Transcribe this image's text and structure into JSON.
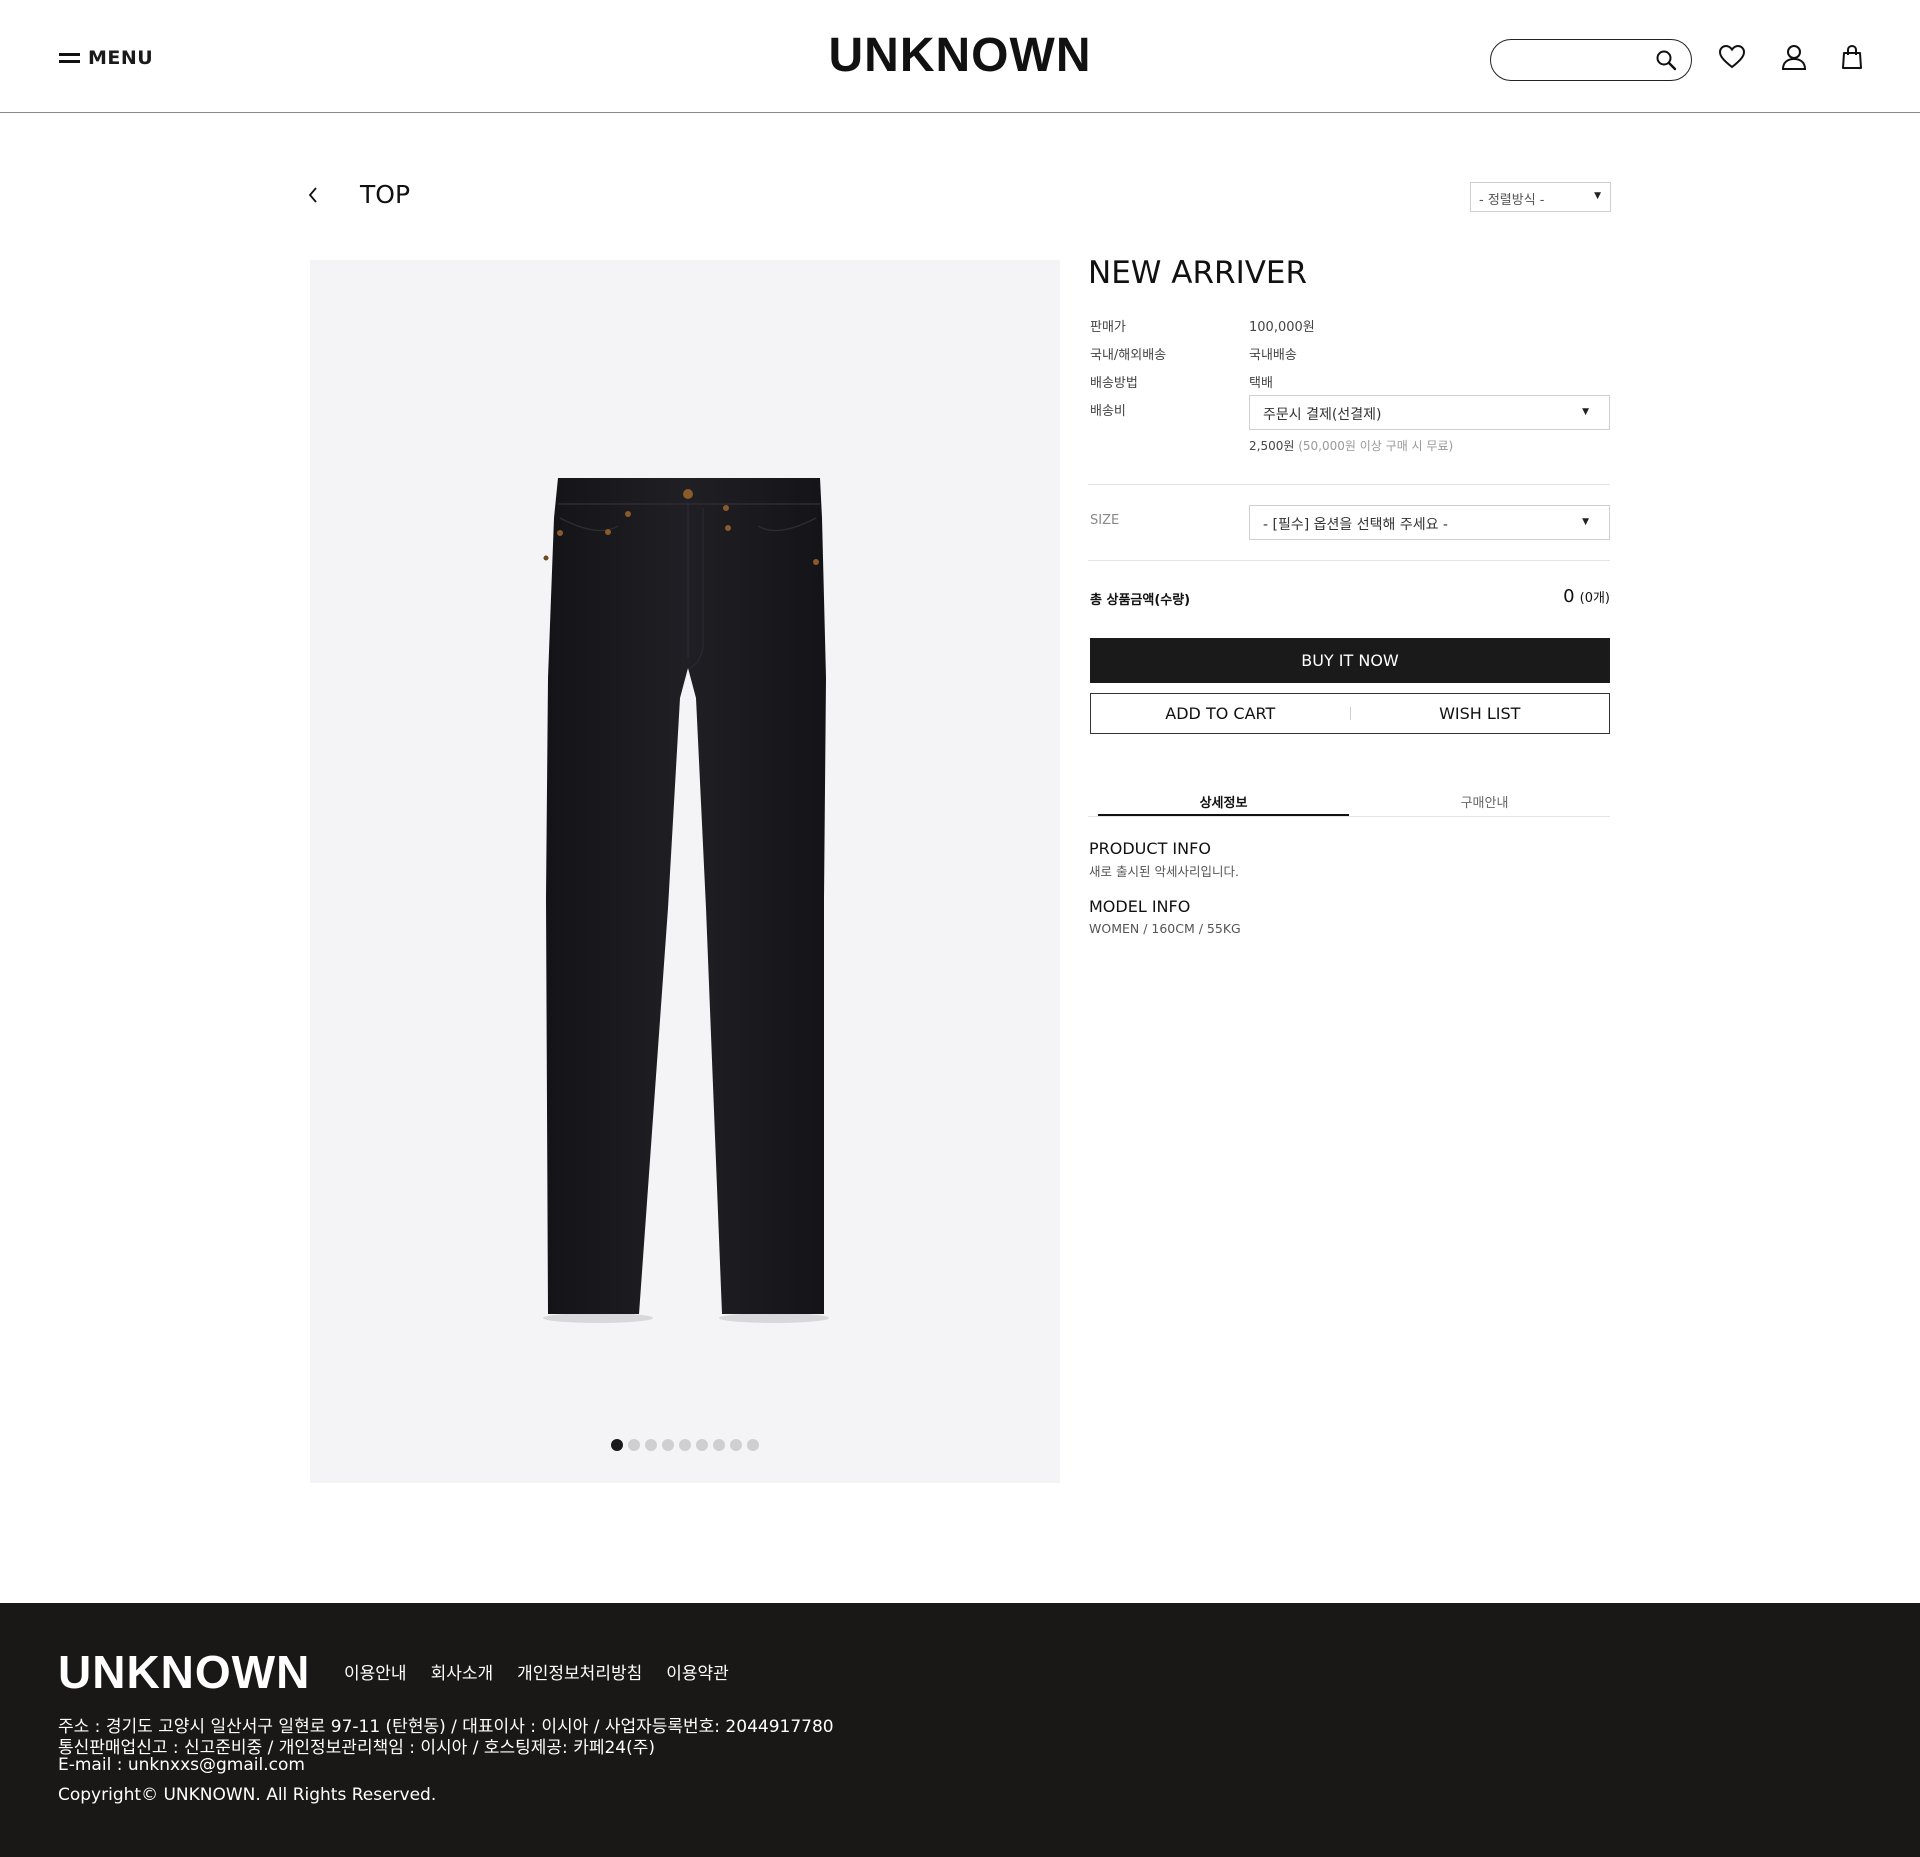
{
  "header": {
    "menu_label": "MENU",
    "logo": "UNKNOWN",
    "search_placeholder": ""
  },
  "listing": {
    "category_title": "TOP",
    "sort_label": "- 정렬방식 -"
  },
  "product": {
    "name": "NEW ARRIVER",
    "rows": [
      {
        "label": "판매가",
        "value": "100,000원"
      },
      {
        "label": "국내/해외배송",
        "value": "국내배송"
      },
      {
        "label": "배송방법",
        "value": "택배"
      },
      {
        "label": "배송비",
        "value": ""
      }
    ],
    "shipping_select": "주문시 결제(선결제)",
    "shipping_fee": "2,500원",
    "shipping_fee_note": "(50,000원 이상 구매 시 무료)",
    "size_label": "SIZE",
    "size_select": "- [필수] 옵션을 선택해 주세요 -",
    "total_label": "총 상품금액(수량)",
    "total_value": "0",
    "total_qty": "(0개)",
    "buy_label": "BUY IT NOW",
    "cart_label": "ADD TO CART",
    "wish_label": "WISH LIST",
    "tabs": [
      "상세정보",
      "구매안내"
    ],
    "product_info_title": "PRODUCT INFO",
    "product_info_text": "새로 출시된 악세사리입니다.",
    "model_info_title": "MODEL INFO",
    "model_info_text": "WOMEN / 160CM / 55KG",
    "gallery": {
      "image_count": 9,
      "active_index": 0
    }
  },
  "footer": {
    "logo": "UNKNOWN",
    "links": [
      "이용안내",
      "회사소개",
      "개인정보처리방침",
      "이용약관"
    ],
    "address": "주소 : 경기도 고양시 일산서구 일현로 97-11 (탄현동) / 대표이사 : 이시아 / 사업자등록번호: 2044917780",
    "license": "통신판매업신고 : 신고준비중 / 개인정보관리책임 : 이시아 / 호스팅제공: 카페24(주)",
    "email": "E-mail : unknxxs@gmail.com",
    "copyright": "Copyright© UNKNOWN. All Rights Reserved."
  },
  "colors": {
    "accent": "#1a1a1a",
    "footer_bg": "#1a1717",
    "image_bg": "#f4f4f6"
  }
}
